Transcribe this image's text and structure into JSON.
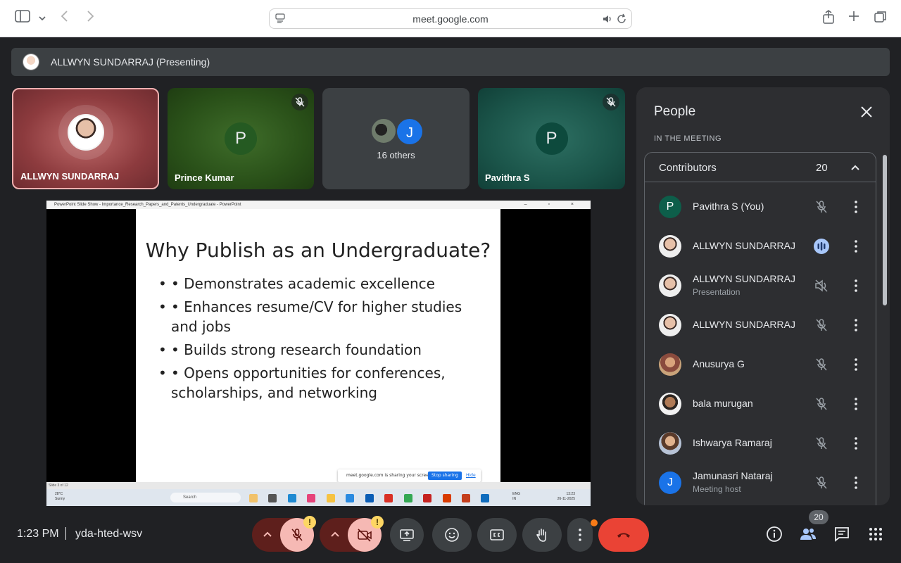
{
  "browser": {
    "url": "meet.google.com"
  },
  "presenting": {
    "text": "ALLWYN SUNDARRAJ (Presenting)"
  },
  "tiles": [
    {
      "name": "ALLWYN SUNDARRAJ"
    },
    {
      "name": "Prince Kumar",
      "letter": "P",
      "muted": true
    },
    {
      "others_letter": "J",
      "others_label": "16 others"
    },
    {
      "name": "Pavithra S",
      "letter": "P",
      "muted": true
    }
  ],
  "shared_screen": {
    "window_title": "PowerPoint Slide Show  -  Importance_Research_Papers_and_Patents_Undergraduate - PowerPoint",
    "slide_title": "Why Publish as an Undergraduate?",
    "bullets": [
      "• Demonstrates academic excellence",
      "• Enhances resume/CV for higher studies and jobs",
      "• Builds strong research foundation",
      "• Opens opportunities for conferences, scholarships, and networking"
    ],
    "share_notice": "meet.google.com is sharing your screen.",
    "stop_sharing": "Stop sharing",
    "hide": "Hide",
    "slide_counter": "Slide 3 of 12",
    "weather_temp": "28°C",
    "weather_desc": "Sunny",
    "taskbar_search": "Search",
    "lang_1": "ENG",
    "lang_2": "IN",
    "clock_time": "13:23",
    "clock_date": "26-11-2025"
  },
  "people_panel": {
    "title": "People",
    "section": "IN THE MEETING",
    "group_label": "Contributors",
    "group_count": "20",
    "participants": [
      {
        "name": "Pavithra S (You)",
        "letter": "P",
        "color": "#0d5e4a",
        "mic": "muted"
      },
      {
        "name": "ALLWYN SUNDARRAJ",
        "mic": "speaking"
      },
      {
        "name": "ALLWYN SUNDARRAJ",
        "sub": "Presentation",
        "mic": "audio-off"
      },
      {
        "name": "ALLWYN SUNDARRAJ",
        "mic": "muted"
      },
      {
        "name": "Anusurya G",
        "mic": "muted"
      },
      {
        "name": "bala murugan",
        "mic": "muted"
      },
      {
        "name": "Ishwarya Ramaraj",
        "mic": "muted"
      },
      {
        "name": "Jamunasri Nataraj",
        "sub": "Meeting host",
        "letter": "J",
        "color": "#1a73e8",
        "mic": "muted"
      }
    ]
  },
  "bottom_bar": {
    "time": "1:23 PM",
    "meeting_code": "yda-hted-wsv",
    "participant_badge": "20",
    "warning_glyph": "!"
  },
  "colors": {
    "end_call": "#ea4335",
    "accent_blue": "#1a73e8",
    "warning": "#fdd663"
  }
}
